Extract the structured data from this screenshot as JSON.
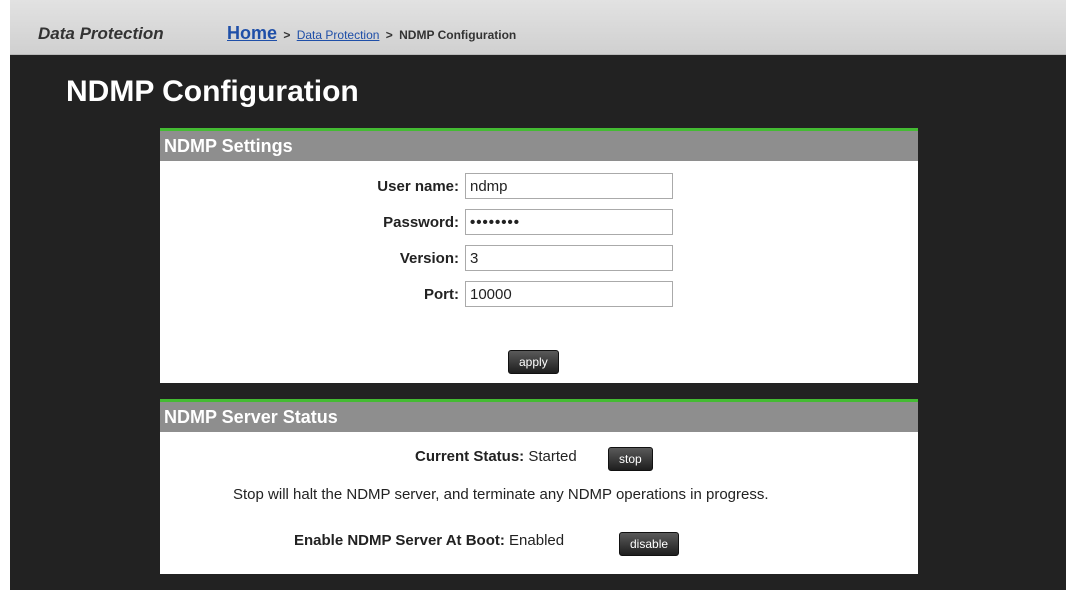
{
  "header": {
    "app_title": "Data Protection",
    "breadcrumb": {
      "home": "Home",
      "separator": ">",
      "section": "Data Protection",
      "current": "NDMP Configuration"
    }
  },
  "page": {
    "title": "NDMP Configuration"
  },
  "settings": {
    "heading": "NDMP Settings",
    "username_label": "User name:",
    "username_value": "ndmp",
    "password_label": "Password:",
    "password_value": "••••••••",
    "version_label": "Version:",
    "version_value": "3",
    "port_label": "Port:",
    "port_value": "10000",
    "apply_label": "apply"
  },
  "server_status": {
    "heading": "NDMP Server Status",
    "current_status_label": "Current Status:",
    "current_status_value": "Started",
    "stop_label": "stop",
    "warning": "Stop will halt the NDMP server, and terminate any NDMP operations in progress.",
    "boot_label": "Enable NDMP Server At Boot:",
    "boot_value": "Enabled",
    "disable_label": "disable"
  },
  "colors": {
    "accent_green": "#44bb33",
    "panel_header_gray": "#8e8e8e",
    "page_background": "#222222",
    "link_blue": "#1f4fa8"
  }
}
